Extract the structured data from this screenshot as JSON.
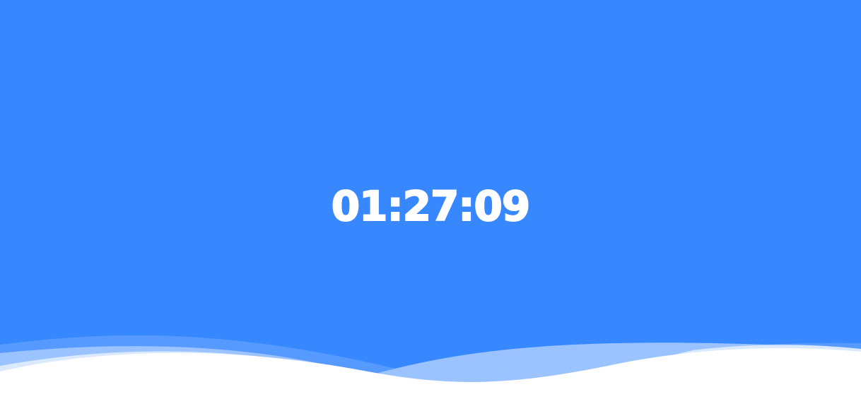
{
  "clock": {
    "time": "01:27:09"
  },
  "colors": {
    "background": "#3787fe",
    "text": "#ffffff",
    "wave_back": "#5a9cff",
    "wave_mid": "#9fc5ff",
    "wave_light": "#dbe9ff",
    "wave_front": "#ffffff"
  }
}
